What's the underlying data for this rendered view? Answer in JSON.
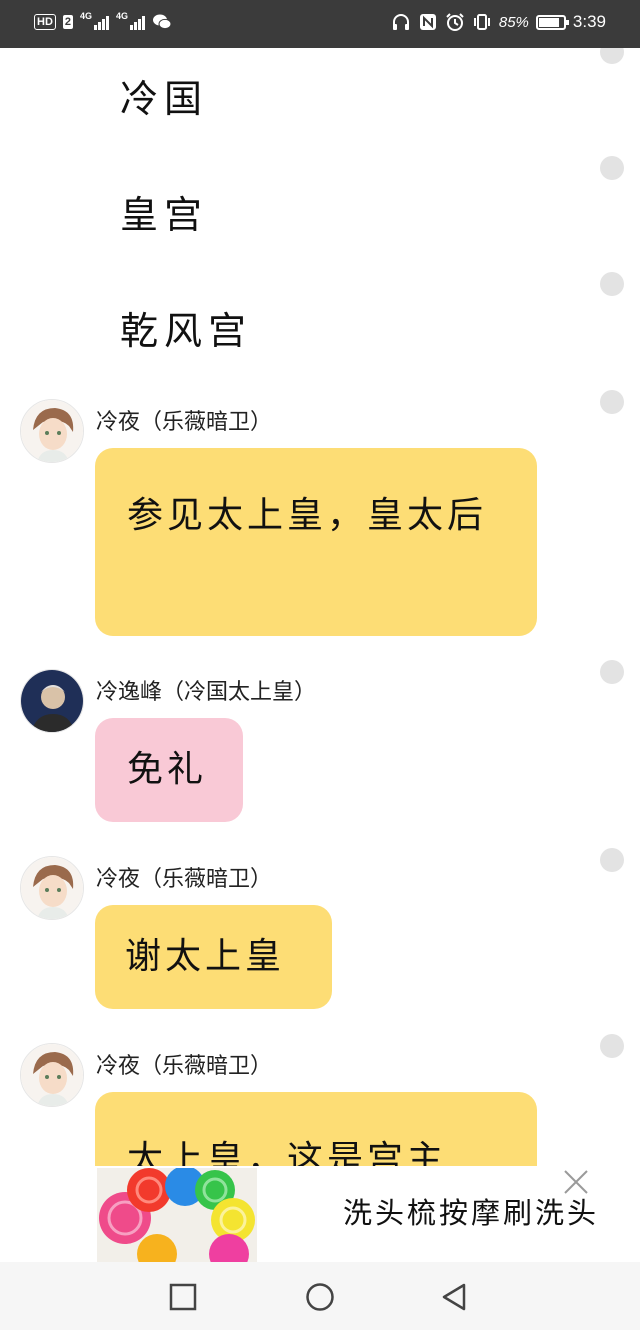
{
  "status_bar": {
    "hd_label": "HD",
    "sim_label": "2",
    "signal_1": "4G",
    "signal_2": "4G",
    "battery_percent_text": "85%",
    "battery_level": 0.85,
    "time": "3:39",
    "icons": [
      "hd-icon",
      "signal-icon",
      "signal-icon",
      "wechat-icon",
      "headphones-icon",
      "nfc-icon",
      "alarm-icon",
      "vibrate-icon",
      "battery-icon"
    ]
  },
  "scene": {
    "lines": [
      "冷国",
      "皇宫",
      "乾风宫"
    ]
  },
  "messages": [
    {
      "sender": "冷夜（乐薇暗卫）",
      "text": "参见太上皇，皇太后",
      "color": "#fddd75"
    },
    {
      "sender": "冷逸峰（冷国太上皇）",
      "text": "免礼",
      "color": "#f9c9d6"
    },
    {
      "sender": "冷夜（乐薇暗卫）",
      "text": "谢太上皇",
      "color": "#fddd75"
    },
    {
      "sender": "冷夜（乐薇暗卫）",
      "text": "太上皇，这是宫主",
      "color": "#fddd75"
    }
  ],
  "ad": {
    "title": "洗头梳按摩刷洗头",
    "close_icon": "close-icon"
  },
  "nav_bar": {
    "icons": [
      "recent-apps-icon",
      "home-icon",
      "back-icon"
    ]
  }
}
